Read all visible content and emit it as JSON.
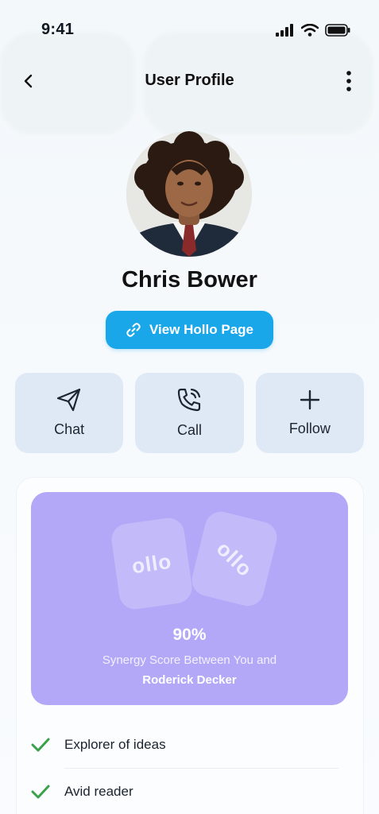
{
  "status_bar": {
    "time": "9:41"
  },
  "header": {
    "title": "User Profile"
  },
  "profile": {
    "name": "Chris Bower",
    "hollo_button_label": "View Hollo Page"
  },
  "actions": [
    {
      "label": "Chat",
      "icon": "send-icon"
    },
    {
      "label": "Call",
      "icon": "phone-call-icon"
    },
    {
      "label": "Follow",
      "icon": "plus-icon"
    }
  ],
  "synergy": {
    "logo_text": "ollo",
    "score": "90%",
    "score_value": 0.9,
    "text": "Synergy Score Between You and",
    "other_person": "Roderick Decker",
    "color": "#b3a8f8"
  },
  "traits": [
    {
      "label": "Explorer of ideas",
      "icon": "check-icon"
    },
    {
      "label": "Avid reader",
      "icon": "check-icon"
    }
  ],
  "colors": {
    "accent": "#1aa7ea",
    "check": "#3aa14a",
    "action_bg": "#dfe9f6"
  }
}
